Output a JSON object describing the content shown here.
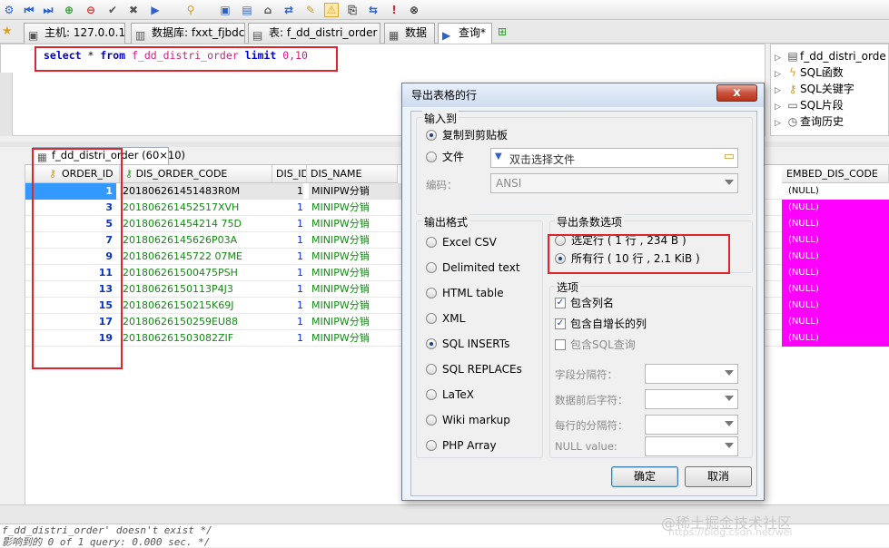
{
  "tabs": [
    {
      "label": "主机: 127.0.0.1"
    },
    {
      "label": "数据库: fxxt_fjbdc"
    },
    {
      "label": "表: f_dd_distri_order"
    },
    {
      "label": "数据"
    },
    {
      "label": "查询*"
    }
  ],
  "editor": {
    "sql_keyword1": "select",
    "sql_star": "*",
    "sql_keyword2": "from",
    "sql_table": "f_dd_distri_order",
    "sql_keyword3": "limit",
    "sql_limit": "0,10"
  },
  "tree": [
    {
      "label": "f_dd_distri_orde",
      "icon": "table-icon"
    },
    {
      "label": "SQL函数",
      "icon": "lightning-icon"
    },
    {
      "label": "SQL关键字",
      "icon": "key-icon"
    },
    {
      "label": "SQL片段",
      "icon": "folder-icon"
    },
    {
      "label": "查询历史",
      "icon": "history-icon"
    }
  ],
  "result_tab": "f_dd_distri_order (60×10)",
  "columns": [
    "ORDER_ID",
    "DIS_ORDER_CODE",
    "DIS_ID",
    "DIS_NAME",
    "EMBED_DIS_CODE"
  ],
  "rows": [
    {
      "id": "1",
      "code": "201806261451483R0M",
      "dis_id": "1",
      "name": "MINIPW分销",
      "embed": "(NULL)"
    },
    {
      "id": "3",
      "code": "201806261452517XVH",
      "dis_id": "1",
      "name": "MINIPW分销",
      "embed": "(NULL)"
    },
    {
      "id": "5",
      "code": "201806261454214 75D",
      "dis_id": "1",
      "name": "MINIPW分销",
      "embed": "(NULL)"
    },
    {
      "id": "7",
      "code": "20180626145626P03A",
      "dis_id": "1",
      "name": "MINIPW分销",
      "embed": "(NULL)"
    },
    {
      "id": "9",
      "code": "20180626145722 07ME",
      "dis_id": "1",
      "name": "MINIPW分销",
      "embed": "(NULL)"
    },
    {
      "id": "11",
      "code": "201806261500475PSH",
      "dis_id": "1",
      "name": "MINIPW分销",
      "embed": "(NULL)"
    },
    {
      "id": "13",
      "code": "20180626150113P4J3",
      "dis_id": "1",
      "name": "MINIPW分销",
      "embed": "(NULL)"
    },
    {
      "id": "15",
      "code": "20180626150215K69J",
      "dis_id": "1",
      "name": "MINIPW分销",
      "embed": "(NULL)"
    },
    {
      "id": "17",
      "code": "20180626150259EU88",
      "dis_id": "1",
      "name": "MINIPW分销",
      "embed": "(NULL)"
    },
    {
      "id": "19",
      "code": "201806261503082ZIF",
      "dis_id": "1",
      "name": "MINIPW分销",
      "embed": "(NULL)"
    }
  ],
  "log": {
    "line1": "f_dd_distri_order' doesn't exist */",
    "line2": "   影响到的 0 of 1 query: 0.000 sec. */"
  },
  "dialog": {
    "title": "导出表格的行",
    "input_to": "输入到",
    "clipboard": "复制到剪贴板",
    "file": "文件",
    "file_placeholder": "双击选择文件",
    "encoding_label": "编码：",
    "encoding_value": "ANSI",
    "output_format": "输出格式",
    "formats": [
      "Excel CSV",
      "Delimited text",
      "HTML table",
      "XML",
      "SQL INSERTs",
      "SQL REPLACEs",
      "LaTeX",
      "Wiki markup",
      "PHP Array"
    ],
    "selected_format": "SQL INSERTs",
    "row_options": "导出条数选项",
    "selected_rows": "选定行 ( 1 行 , 234 B )",
    "all_rows": "所有行 ( 10 行 , 2.1 KiB )",
    "options": "选项",
    "include_columns": "包含列名",
    "include_autoinc": "包含自增长的列",
    "include_sql": "包含SQL查询",
    "field_sep": "字段分隔符：",
    "field_enclose": "数据前后字符：",
    "row_sep": "每行的分隔符：",
    "null_value": "NULL value:",
    "ok": "确定",
    "cancel": "取消",
    "close": "x"
  },
  "watermark": "@稀土掘金技术社区",
  "watermark_url": "https://blog.csdn.net/wei"
}
